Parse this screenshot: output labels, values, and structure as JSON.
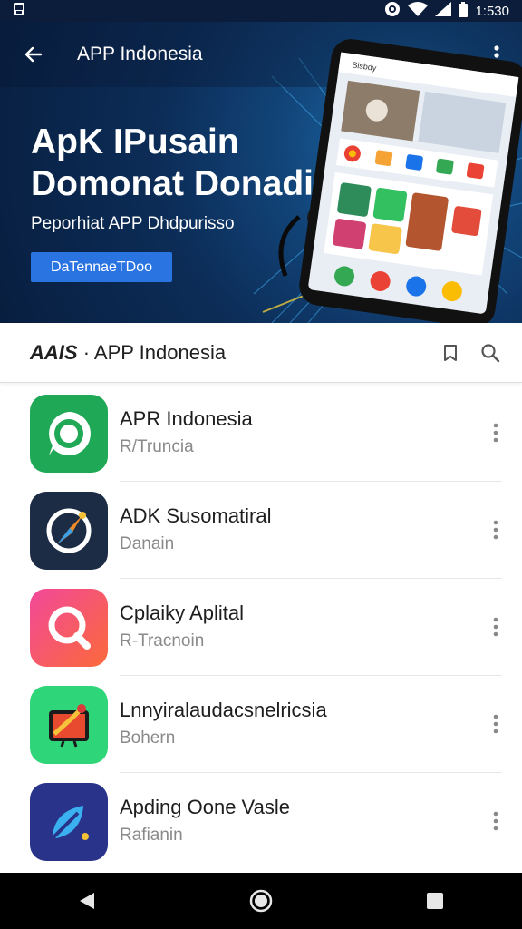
{
  "status_bar": {
    "time": "1:530"
  },
  "app_bar": {
    "title": "APP Indonesia"
  },
  "hero": {
    "title_line1": "ApK IPusain",
    "title_line2": "Domonat Donadia",
    "subtitle": "Peporhiat APP Dhdpurisso",
    "cta_label": "DaTennaeTDoo"
  },
  "phone_screen": {
    "search_text": "Sisbdy"
  },
  "toolbar": {
    "title_brand": "AAIS",
    "title_rest": "· APP Indonesia"
  },
  "apps": [
    {
      "name": "APR Indonesia",
      "subtitle": "R/Truncia",
      "icon": "whatsapp-icon",
      "color": "#1fa855"
    },
    {
      "name": "ADK Susomatiral",
      "subtitle": "Danain",
      "icon": "compass-icon",
      "color": "#1d2c45"
    },
    {
      "name": "Cplaiky Aplital",
      "subtitle": "R-Tracnoin",
      "icon": "search-icon",
      "color": "#f5556a"
    },
    {
      "name": "Lnnyiralaudacsnelricsia",
      "subtitle": "Bohern",
      "icon": "presentation-icon",
      "color": "#2fd579"
    },
    {
      "name": "Apding Oone Vasle",
      "subtitle": "Rafianin",
      "icon": "leaf-icon",
      "color": "#283389"
    }
  ],
  "colors": {
    "hero_dark": "#081e3f",
    "cta_blue": "#2a74e2",
    "nav_bar": "#000000"
  }
}
